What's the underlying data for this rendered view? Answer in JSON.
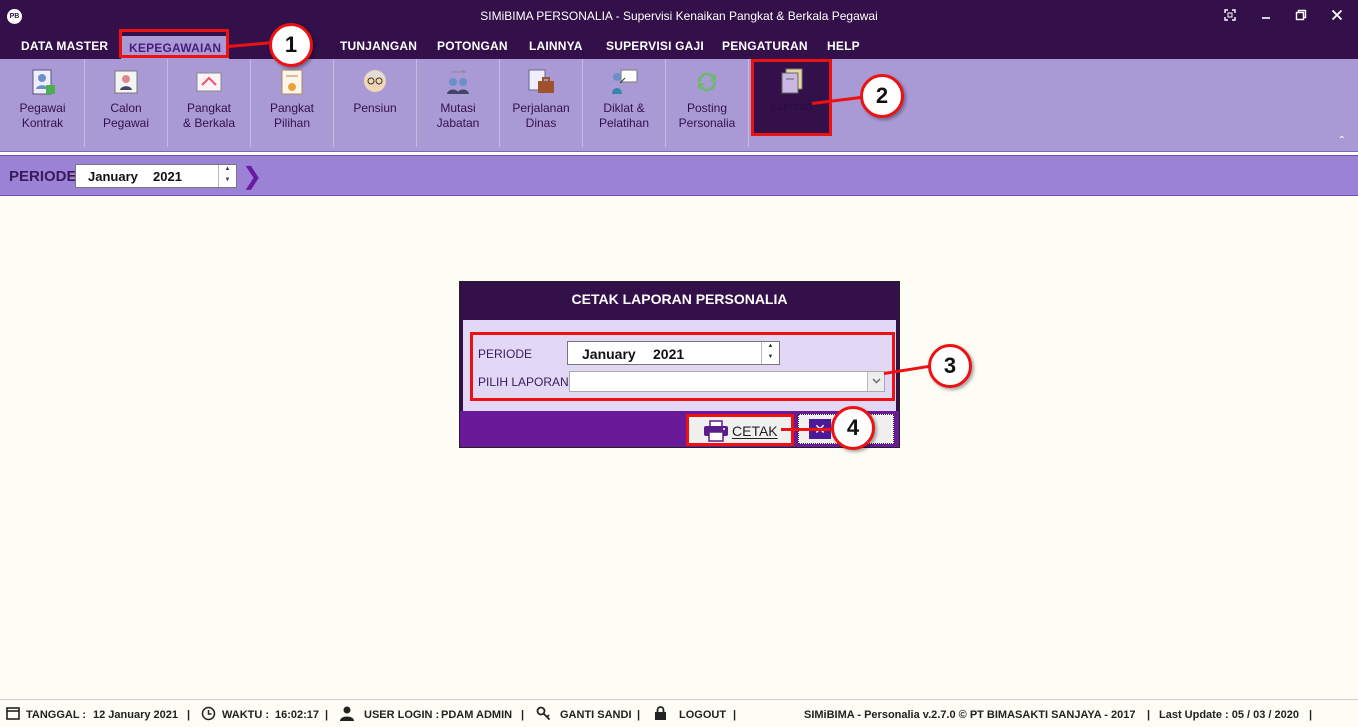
{
  "window": {
    "title": "SIMiBIMA PERSONALIA - Supervisi Kenaikan Pangkat & Berkala Pegawai",
    "app_icon_text": "PB"
  },
  "menu": {
    "items": [
      "DATA MASTER",
      "KEPEGAWAIAN",
      "TUNJANGAN",
      "POTONGAN",
      "LAINNYA",
      "SUPERVISI GAJI",
      "PENGATURAN",
      "HELP"
    ],
    "active": "KEPEGAWAIAN"
  },
  "ribbon": {
    "buttons": [
      {
        "label1": "Pegawai",
        "label2": "Kontrak"
      },
      {
        "label1": "Calon",
        "label2": "Pegawai"
      },
      {
        "label1": "Pangkat",
        "label2": "& Berkala"
      },
      {
        "label1": "Pangkat",
        "label2": "Pilihan"
      },
      {
        "label1": "Pensiun",
        "label2": ""
      },
      {
        "label1": "Mutasi",
        "label2": "Jabatan"
      },
      {
        "label1": "Perjalanan",
        "label2": "Dinas"
      },
      {
        "label1": "Diklat &",
        "label2": "Pelatihan"
      },
      {
        "label1": "Posting",
        "label2": "Personalia"
      },
      {
        "label1": "Laporan",
        "label2": ""
      }
    ],
    "collapse_glyph": "⌃"
  },
  "periode_bar": {
    "label": "PERIODE",
    "month": "January",
    "year": "2021",
    "go_glyph": "❯"
  },
  "dialog": {
    "title": "CETAK LAPORAN PERSONALIA",
    "periode_label": "PERIODE",
    "periode_month": "January",
    "periode_year": "2021",
    "pilih_label": "PILIH LAPORAN",
    "pilih_value": "",
    "cetak_label": "CETAK",
    "close_glyph": "✕"
  },
  "annotations": [
    "1",
    "2",
    "3",
    "4"
  ],
  "statusbar": {
    "tanggal_label": "TANGGAL :",
    "tanggal_value": "12 January 2021",
    "waktu_label": "WAKTU :",
    "waktu_value": "16:02:17",
    "user_label": "USER LOGIN :",
    "user_value": "PDAM ADMIN",
    "ganti_sandi": "GANTI SANDI",
    "logout": "LOGOUT",
    "separator": "|",
    "product": "SIMiBIMA - Personalia v.2.7.0 © PT BIMASAKTI SANJAYA - 2017",
    "last_update": "Last Update : 05 / 03 / 2020"
  },
  "colors": {
    "titlebar": "#34104a",
    "ribbon": "#a99ad6",
    "periode_bar": "#9c82d6",
    "highlight": "#ee1111",
    "dialog_body": "#e2d8f5",
    "dialog_footer": "#6a1a98"
  }
}
